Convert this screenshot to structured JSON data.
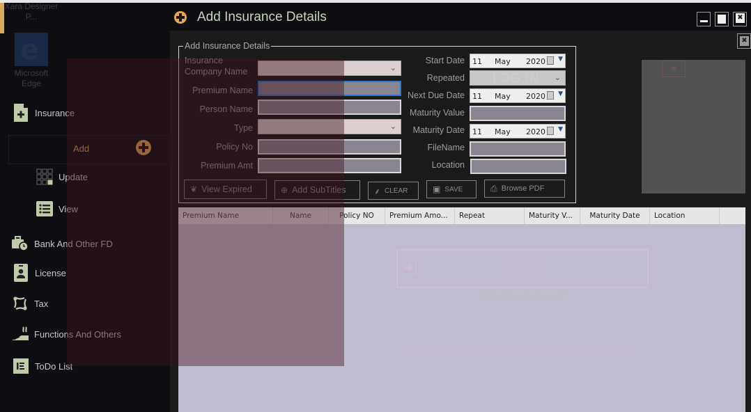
{
  "desktop": {
    "icons": [
      {
        "label": "Xara Designer P..."
      },
      {
        "label": "Microsoft Edge"
      }
    ]
  },
  "sidebar": {
    "items": [
      {
        "label": "Insurance",
        "icon": "file-plus-icon"
      },
      {
        "label": "Add",
        "icon": "plus-circle-icon",
        "active": true
      },
      {
        "label": "Update",
        "icon": "grid-icon"
      },
      {
        "label": "View",
        "icon": "list-icon"
      },
      {
        "label": "Bank And Other FD",
        "icon": "briefcase-clock-icon"
      },
      {
        "label": "License",
        "icon": "id-badge-icon"
      },
      {
        "label": "Tax",
        "icon": "tax-cycle-icon"
      },
      {
        "label": "Functions And Others",
        "icon": "functions-icon"
      },
      {
        "label": "ToDo List",
        "icon": "todo-icon"
      }
    ]
  },
  "header": {
    "title": "Add Insurance Details",
    "window_controls": [
      "minimize",
      "maximize",
      "close"
    ]
  },
  "form": {
    "legend": "Add Insurance Details",
    "left_fields": [
      {
        "label": "Insurance Company Name",
        "type": "select",
        "value": ""
      },
      {
        "label": "Premium Name",
        "type": "text",
        "value": "",
        "focused": true
      },
      {
        "label": "Person Name",
        "type": "text",
        "value": ""
      },
      {
        "label": "Type",
        "type": "select",
        "value": ""
      },
      {
        "label": "Policy No",
        "type": "text",
        "value": ""
      },
      {
        "label": "Premium Amt",
        "type": "text",
        "value": ""
      }
    ],
    "right_fields": [
      {
        "label": "Start Date",
        "type": "date",
        "day": "11",
        "month": "May",
        "year": "2020"
      },
      {
        "label": "Repeated",
        "type": "select",
        "value": ""
      },
      {
        "label": "Next Due Date",
        "type": "date",
        "day": "11",
        "month": "May",
        "year": "2020"
      },
      {
        "label": "Maturity Value",
        "type": "text",
        "value": ""
      },
      {
        "label": "Maturity Date",
        "type": "date",
        "day": "11",
        "month": "May",
        "year": "2020"
      },
      {
        "label": "FileName",
        "type": "text",
        "value": ""
      },
      {
        "label": "Location",
        "type": "text",
        "value": ""
      }
    ],
    "buttons": [
      {
        "label": "View Expired",
        "icon": "leaf-icon"
      },
      {
        "label": "Add SubTitles",
        "icon": "plus-circle-icon"
      },
      {
        "label": "CLEAR",
        "icon": "broom-icon"
      },
      {
        "label": "SAVE",
        "icon": "floppy-icon"
      },
      {
        "label": "Browse PDF",
        "icon": "pdf-icon"
      }
    ]
  },
  "table": {
    "columns": [
      "Premium Name",
      "Name",
      "Policy NO",
      "Premium Amo...",
      "Repeat",
      "Maturity V...",
      "Maturity Date",
      "Location"
    ],
    "rows": []
  },
  "ghost_overlay": {
    "login_text": "LOG IN",
    "signin_text": "SIGN IN",
    "forgot_text": "Forgot Your Password?"
  }
}
